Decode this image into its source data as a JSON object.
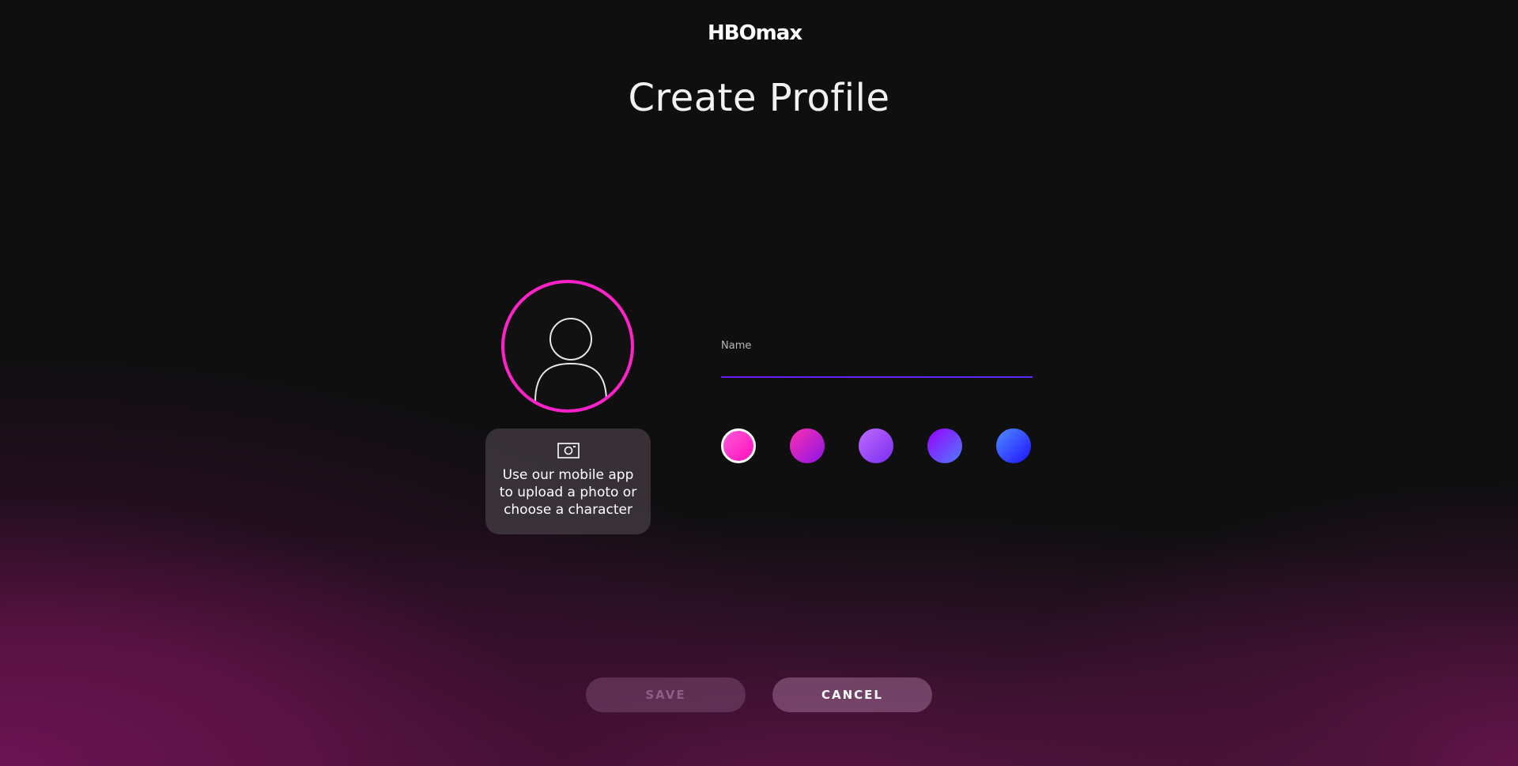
{
  "header": {
    "logo_text": "HBOmax",
    "title": "Create Profile"
  },
  "avatar": {
    "icon": "user-silhouette-icon",
    "ring_color": "#ff22c9"
  },
  "upload_card": {
    "icon": "camera-icon",
    "text": "Use our mobile app to upload a photo or choose a character"
  },
  "name_field": {
    "label": "Name",
    "value": "",
    "underline_color": "#6b1cff"
  },
  "color_swatches": [
    {
      "name": "pink",
      "gradient": [
        "#ff59d6",
        "#ff0fbf"
      ],
      "selected": true
    },
    {
      "name": "magenta-purple",
      "gradient": [
        "#ff2fb0",
        "#8b14e6"
      ],
      "selected": false
    },
    {
      "name": "lavender",
      "gradient": [
        "#c06bff",
        "#7a2cf0"
      ],
      "selected": false
    },
    {
      "name": "violet-blue",
      "gradient": [
        "#9a00ff",
        "#4d7cff"
      ],
      "selected": false
    },
    {
      "name": "blue",
      "gradient": [
        "#4f8dff",
        "#1f10ff"
      ],
      "selected": false
    }
  ],
  "actions": {
    "save_label": "SAVE",
    "save_enabled": false,
    "cancel_label": "CANCEL"
  },
  "colors": {
    "background": "#0f0f10",
    "accent_magenta": "#ff22c9",
    "accent_purple": "#6b1cff"
  }
}
